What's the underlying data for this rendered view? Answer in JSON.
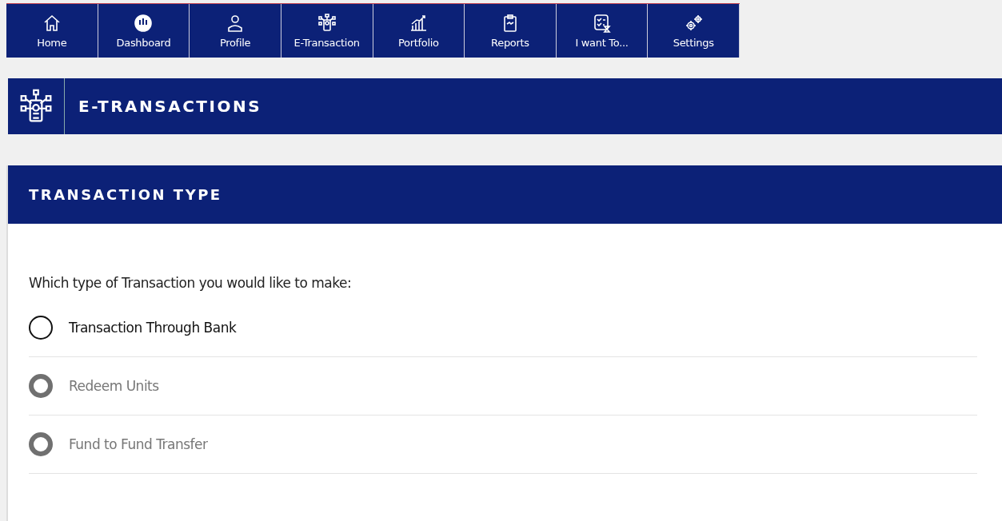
{
  "nav": [
    {
      "label": "Home"
    },
    {
      "label": "Dashboard"
    },
    {
      "label": "Profile"
    },
    {
      "label": "E-Transaction"
    },
    {
      "label": "Portfolio"
    },
    {
      "label": "Reports"
    },
    {
      "label": "I want To..."
    },
    {
      "label": "Settings"
    }
  ],
  "page_title": "E-TRANSACTIONS",
  "card": {
    "title": "TRANSACTION TYPE",
    "question": "Which type of Transaction you would like to make:",
    "options": [
      {
        "label": "Transaction Through Bank",
        "selected": false,
        "disabled": false
      },
      {
        "label": "Redeem Units",
        "selected": false,
        "disabled": true
      },
      {
        "label": "Fund to Fund Transfer",
        "selected": false,
        "disabled": true
      }
    ]
  }
}
